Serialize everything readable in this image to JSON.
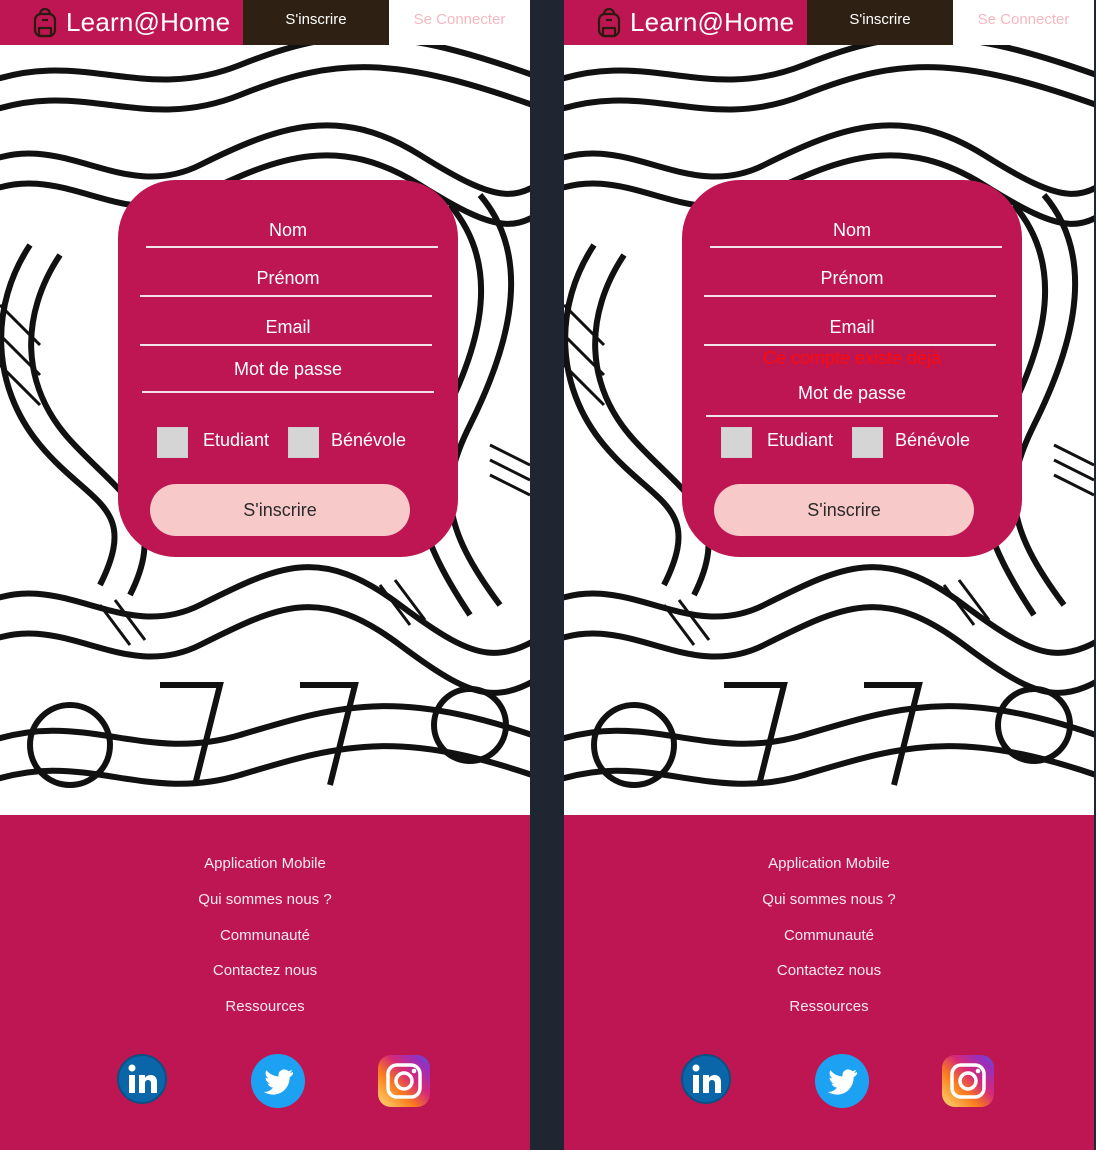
{
  "screens": [
    {
      "header": {
        "brand": "Learn@Home",
        "signup_tab": "S'inscrire",
        "login_tab": "Se Connecter"
      },
      "form": {
        "nom": "Nom",
        "prenom": "Prénom",
        "email": "Email",
        "error": "",
        "password": "Mot de passe",
        "student": "Etudiant",
        "volunteer": "Bénévole",
        "submit": "S'inscrire"
      },
      "footer": {
        "links": [
          "Application Mobile",
          "Qui sommes nous ?",
          "Communauté",
          "Contactez nous",
          "Ressources"
        ],
        "social_icons": [
          "linkedin-icon",
          "twitter-icon",
          "instagram-icon"
        ]
      }
    },
    {
      "header": {
        "brand": "Learn@Home",
        "signup_tab": "S'inscrire",
        "login_tab": "Se Connecter"
      },
      "form": {
        "nom": "Nom",
        "prenom": "Prénom",
        "email": "Email",
        "error": "Ce compte existe déjà",
        "password": "Mot de passe",
        "student": "Etudiant",
        "volunteer": "Bénévole",
        "submit": "S'inscrire"
      },
      "footer": {
        "links": [
          "Application Mobile",
          "Qui sommes nous ?",
          "Communauté",
          "Contactez nous",
          "Ressources"
        ],
        "social_icons": [
          "linkedin-icon",
          "twitter-icon",
          "instagram-icon"
        ]
      }
    }
  ],
  "colors": {
    "brand": "#be1652",
    "dark_tab": "#2e2113",
    "login_text": "#f6b8c0",
    "button": "#f7c9c9",
    "error": "#ff0a0a",
    "separator": "#1f2632"
  }
}
